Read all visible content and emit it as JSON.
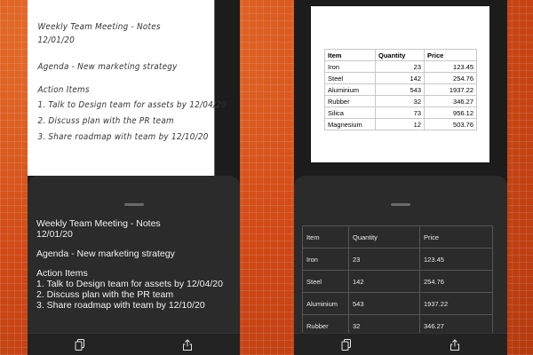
{
  "left_panel": {
    "handwritten": {
      "title": "Weekly Team Meeting - Notes",
      "date": "12/01/20",
      "agenda": "Agenda - New marketing strategy",
      "action_header": "Action Items",
      "items": [
        "1. Talk to Design team for assets by 12/04/20",
        "2. Discuss plan with the PR team",
        "3. Share roadmap with team by 12/10/20"
      ]
    },
    "recognized": {
      "title": "Weekly Team Meeting - Notes",
      "date": "12/01/20",
      "agenda": "Agenda - New marketing strategy",
      "action_header": "Action Items",
      "items": [
        "1. Talk to Design team for assets by 12/04/20",
        "2. Discuss plan with the PR team",
        "3. Share roadmap with team by 12/10/20"
      ]
    },
    "toolbar": {
      "icons": [
        "copy-icon",
        "share-icon"
      ]
    }
  },
  "right_panel": {
    "photo_table": {
      "headers": [
        "Item",
        "Quantity",
        "Price"
      ],
      "rows": [
        [
          "Iron",
          "23",
          "123.45"
        ],
        [
          "Steel",
          "142",
          "254.76"
        ],
        [
          "Aluminium",
          "543",
          "1937.22"
        ],
        [
          "Rubber",
          "32",
          "346.27"
        ],
        [
          "Silica",
          "73",
          "956.12"
        ],
        [
          "Magnesium",
          "12",
          "503.76"
        ]
      ]
    },
    "recognized_table": {
      "headers": [
        "Item",
        "Quantity",
        "Price"
      ],
      "rows": [
        [
          "Iron",
          "23",
          "123.45"
        ],
        [
          "Steel",
          "142",
          "254.76"
        ],
        [
          "Aluminium",
          "543",
          "1937.22"
        ],
        [
          "Rubber",
          "32",
          "346.27"
        ]
      ]
    },
    "toolbar": {
      "icons": [
        "copy-icon",
        "share-icon"
      ]
    }
  }
}
